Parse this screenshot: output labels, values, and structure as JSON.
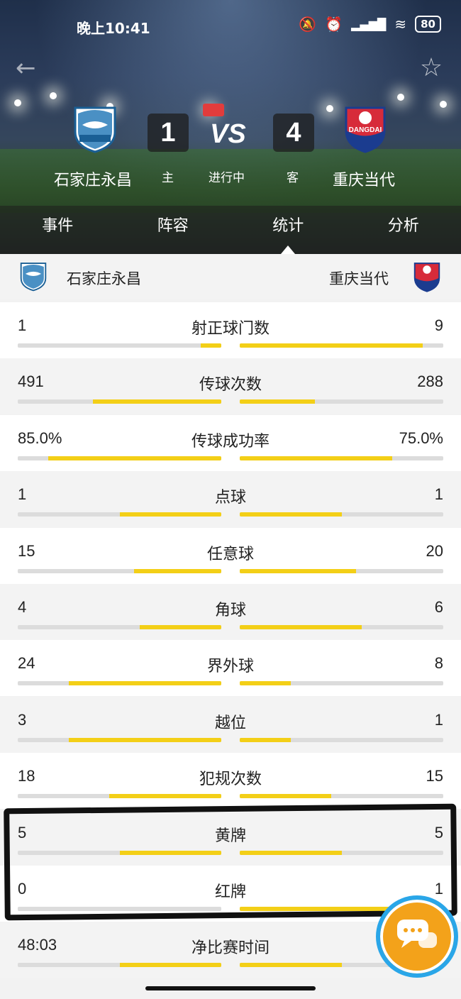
{
  "status_bar": {
    "time": "晚上10:41",
    "battery": "80"
  },
  "match": {
    "home_team": "石家庄永昌",
    "away_team": "重庆当代",
    "home_score": "1",
    "away_score": "4",
    "vs": "VS",
    "home_side": "主",
    "away_side": "客",
    "status": "进行中",
    "away_logo_text": "DANGDAI"
  },
  "tabs": [
    {
      "label": "事件"
    },
    {
      "label": "阵容"
    },
    {
      "label": "统计",
      "active": true
    },
    {
      "label": "分析"
    }
  ],
  "stats": [
    {
      "label": "射正球门数",
      "home": "1",
      "away": "9",
      "home_pct": 0.1,
      "away_pct": 0.9
    },
    {
      "label": "传球次数",
      "home": "491",
      "away": "288",
      "home_pct": 0.63,
      "away_pct": 0.37
    },
    {
      "label": "传球成功率",
      "home": "85.0%",
      "away": "75.0%",
      "home_pct": 0.85,
      "away_pct": 0.75
    },
    {
      "label": "点球",
      "home": "1",
      "away": "1",
      "home_pct": 0.5,
      "away_pct": 0.5
    },
    {
      "label": "任意球",
      "home": "15",
      "away": "20",
      "home_pct": 0.43,
      "away_pct": 0.57
    },
    {
      "label": "角球",
      "home": "4",
      "away": "6",
      "home_pct": 0.4,
      "away_pct": 0.6
    },
    {
      "label": "界外球",
      "home": "24",
      "away": "8",
      "home_pct": 0.75,
      "away_pct": 0.25
    },
    {
      "label": "越位",
      "home": "3",
      "away": "1",
      "home_pct": 0.75,
      "away_pct": 0.25
    },
    {
      "label": "犯规次数",
      "home": "18",
      "away": "15",
      "home_pct": 0.55,
      "away_pct": 0.45
    },
    {
      "label": "黄牌",
      "home": "5",
      "away": "5",
      "home_pct": 0.5,
      "away_pct": 0.5
    },
    {
      "label": "红牌",
      "home": "0",
      "away": "1",
      "home_pct": 0.0,
      "away_pct": 1.0
    },
    {
      "label": "净比赛时间",
      "home": "48:03",
      "away": "",
      "home_pct": 0.5,
      "away_pct": 0.5
    }
  ],
  "colors": {
    "bar_fill": "#f3cf17",
    "bar_bg": "#dcdcdc",
    "chat_bg": "#f3a21a",
    "chat_ring": "#2aa6e8"
  },
  "icons": [
    "back-arrow-icon",
    "star-icon",
    "chat-bubble-icon",
    "mute-icon",
    "alarm-icon",
    "signal-icon",
    "wifi-icon"
  ]
}
